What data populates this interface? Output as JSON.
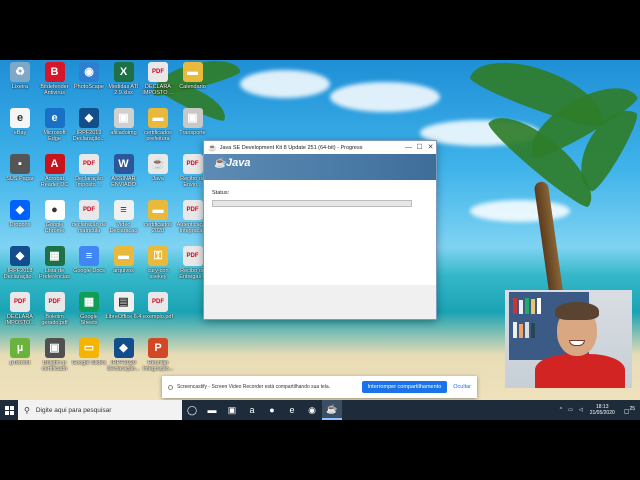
{
  "desktop": {
    "icons": [
      {
        "label": "Lixeira",
        "icon": "recycle-bin-icon",
        "color": "#7fa7c8",
        "glyph": "♻"
      },
      {
        "label": "Bitdefender Antivirus",
        "icon": "bitdefender-icon",
        "color": "#d6172b",
        "glyph": "B"
      },
      {
        "label": "PhotoScape",
        "icon": "photoscape-icon",
        "color": "#2e7fd1",
        "glyph": "◉"
      },
      {
        "label": "Medidas ATI 2.9.xlsx",
        "icon": "excel-icon",
        "color": "#1e7145",
        "glyph": "X"
      },
      {
        "label": "DECLARA IMPOSTO ...",
        "icon": "pdf-icon",
        "color": "#e8e8e8",
        "glyph": "PDF"
      },
      {
        "label": "Calendario",
        "icon": "folder-icon",
        "color": "#e8b93a",
        "glyph": "▬"
      },
      {
        "label": "eBay",
        "icon": "ebay-icon",
        "color": "#f5f5f5",
        "glyph": "e"
      },
      {
        "label": "Microsoft Edge",
        "icon": "edge-icon",
        "color": "#1a6fc7",
        "glyph": "e"
      },
      {
        "label": "IRPF2019 Declaração...",
        "icon": "irpf-icon",
        "color": "#124e8c",
        "glyph": "◆"
      },
      {
        "label": "afiliadoimg",
        "icon": "image-icon",
        "color": "#d0d0d0",
        "glyph": "▣"
      },
      {
        "label": "certificados prefeitura",
        "icon": "folder-icon",
        "color": "#e8b93a",
        "glyph": "▬"
      },
      {
        "label": "Transporte",
        "icon": "image-icon",
        "color": "#c8c8c8",
        "glyph": "▣"
      },
      {
        "label": "SUS Pagar",
        "icon": "app-icon",
        "color": "#555555",
        "glyph": "▪"
      },
      {
        "label": "Acrobat Reader DC",
        "icon": "acrobat-icon",
        "color": "#c8131b",
        "glyph": "A"
      },
      {
        "label": "Declaração Imposto ...",
        "icon": "pdf-icon",
        "color": "#e8e8e8",
        "glyph": "PDF"
      },
      {
        "label": "ASSINAR ENVIADO",
        "icon": "word-icon",
        "color": "#2b579a",
        "glyph": "W"
      },
      {
        "label": "Java",
        "icon": "java-icon",
        "color": "#e8e8e8",
        "glyph": "☕"
      },
      {
        "label": "Recibo de Envio...",
        "icon": "pdf-icon",
        "color": "#e8e8e8",
        "glyph": "PDF"
      },
      {
        "label": "Dropbox",
        "icon": "dropbox-icon",
        "color": "#0061fe",
        "glyph": "◆"
      },
      {
        "label": "Google Chrome",
        "icon": "chrome-icon",
        "color": "#ffffff",
        "glyph": "●"
      },
      {
        "label": "declaração de matricula",
        "icon": "pdf-icon",
        "color": "#e8e8e8",
        "glyph": "PDF"
      },
      {
        "label": "Video Declaracao",
        "icon": "document-icon",
        "color": "#f0f0f0",
        "glyph": "≡"
      },
      {
        "label": "certificados 2020",
        "icon": "folder-icon",
        "color": "#e8b93a",
        "glyph": "▬"
      },
      {
        "label": "Autenticação Integracao",
        "icon": "pdf-icon",
        "color": "#e8e8e8",
        "glyph": "PDF"
      },
      {
        "label": "IRPF2018 Declaração...",
        "icon": "irpf-icon",
        "color": "#124e8c",
        "glyph": "◆"
      },
      {
        "label": "Lista de Preferências",
        "icon": "sheet-icon",
        "color": "#1e7145",
        "glyph": "▦"
      },
      {
        "label": "Google Docs",
        "icon": "docs-icon",
        "color": "#4285f4",
        "glyph": "≡"
      },
      {
        "label": "arquivos",
        "icon": "folder-icon",
        "color": "#e8b93a",
        "glyph": "▬"
      },
      {
        "label": "cury-con ssekey",
        "icon": "key-icon",
        "color": "#e8b93a",
        "glyph": "⚿"
      },
      {
        "label": "Recibo de Entregas...",
        "icon": "pdf-icon",
        "color": "#e8e8e8",
        "glyph": "PDF"
      },
      {
        "label": "DECLARA IMPOSTO...",
        "icon": "pdf-icon",
        "color": "#e8e8e8",
        "glyph": "PDF"
      },
      {
        "label": "Boletim gerado.pdf",
        "icon": "pdf-icon",
        "color": "#e8e8e8",
        "glyph": "PDF"
      },
      {
        "label": "Google Sheets",
        "icon": "sheets-icon",
        "color": "#0f9d58",
        "glyph": "▦"
      },
      {
        "label": "LibreOffice 6.4",
        "icon": "libreoffice-icon",
        "color": "#f0f0f0",
        "glyph": "▤"
      },
      {
        "label": "exemplo.pdf",
        "icon": "pdf-icon",
        "color": "#e8e8e8",
        "glyph": "PDF"
      },
      {
        "label": "",
        "icon": "blank-icon",
        "color": "transparent",
        "glyph": ""
      },
      {
        "label": "µTorrent",
        "icon": "utorrent-icon",
        "color": "#6cb33e",
        "glyph": "µ"
      },
      {
        "label": "Boletim p certificado",
        "icon": "image-icon",
        "color": "#505050",
        "glyph": "▣"
      },
      {
        "label": "Google Slides",
        "icon": "slides-icon",
        "color": "#f4b400",
        "glyph": "▭"
      },
      {
        "label": "IRPF2020 Declaração...",
        "icon": "irpf-icon",
        "color": "#124e8c",
        "glyph": "◆"
      },
      {
        "label": "Reunião Integração...",
        "icon": "powerpoint-icon",
        "color": "#d24726",
        "glyph": "P"
      }
    ]
  },
  "java_window": {
    "title": "Java SE Development Kit 8 Update 251 (64-bit) - Progress",
    "logo_text": "Java",
    "status_label": "Status:",
    "progress": 0
  },
  "screencastify": {
    "message": "Screencastify - Screen Video Recorder está compartilhando sua tela.",
    "stop_label": "Interromper compartilhamento",
    "hide_label": "Ocultar"
  },
  "taskbar": {
    "search_placeholder": "Digite aqui para pesquisar",
    "apps": [
      {
        "name": "task-view-icon",
        "glyph": "◯"
      },
      {
        "name": "file-explorer-icon",
        "glyph": "▬"
      },
      {
        "name": "store-icon",
        "glyph": "▣"
      },
      {
        "name": "amazon-icon",
        "glyph": "a"
      },
      {
        "name": "firefox-icon",
        "glyph": "●"
      },
      {
        "name": "edge-icon",
        "glyph": "e"
      },
      {
        "name": "chrome-icon",
        "glyph": "◉"
      },
      {
        "name": "java-installer-icon",
        "glyph": "☕"
      }
    ],
    "time": "18:13",
    "date": "21/05/2020",
    "notification_count": "25"
  }
}
